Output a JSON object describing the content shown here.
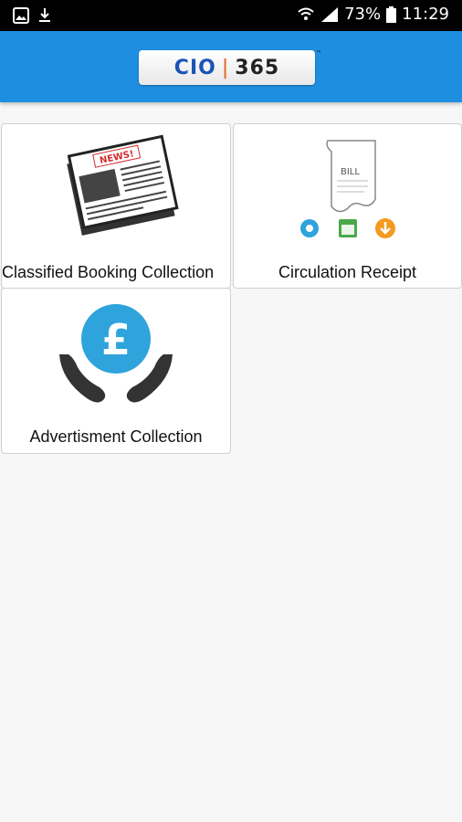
{
  "status_bar": {
    "battery": "73%",
    "time": "11:29",
    "icons": [
      "image-icon",
      "download-icon",
      "wifi-icon",
      "signal-icon",
      "battery-icon"
    ]
  },
  "app_bar": {
    "logo_left": "CIO",
    "logo_right": "365",
    "logo_tm": "™"
  },
  "tiles": [
    {
      "label": "Classified Booking Collection",
      "icon": "newspaper-icon"
    },
    {
      "label": "Circulation Receipt",
      "icon": "bill-receipt-icon"
    },
    {
      "label": "Advertisment Collection",
      "icon": "pound-hands-icon"
    }
  ],
  "colors": {
    "app_bar": "#1e8fe0",
    "accent_orange": "#e0621b",
    "status_bar": "#000000",
    "pound_circle": "#2ea3dc"
  }
}
